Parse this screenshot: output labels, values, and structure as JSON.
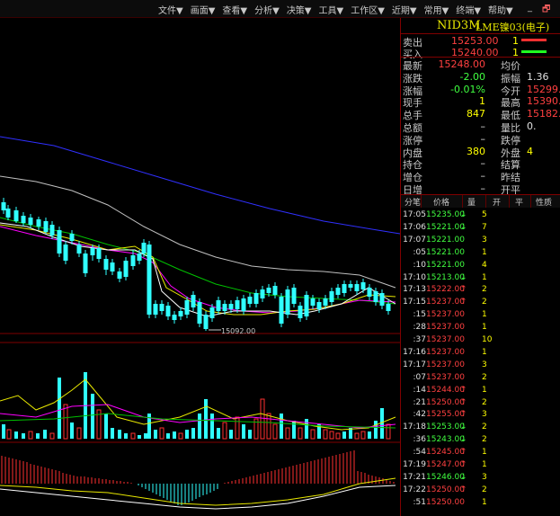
{
  "menu": [
    "文件▼",
    "画面▼",
    "查看▼",
    "分析▼",
    "决策▼",
    "工具▼",
    "工作区▼",
    "近期▼",
    "常用▼",
    "终端▼",
    "帮助▼"
  ],
  "window_controls": [
    "_",
    "🗗"
  ],
  "instrument": {
    "code": "NID3M",
    "name": "LME镍03(电子)"
  },
  "orderbook": [
    {
      "label": "卖出",
      "price": "15253.00",
      "qty": "1",
      "bar_color": "#ff3030"
    },
    {
      "label": "买入",
      "price": "15240.00",
      "qty": "1",
      "bar_color": "#20ff20"
    }
  ],
  "quote_left": [
    {
      "label": "最新",
      "value": "15248.00",
      "color": "red"
    },
    {
      "label": "涨跌",
      "value": "-2.00",
      "color": "grn"
    },
    {
      "label": "涨幅",
      "value": "-0.01%",
      "color": "grn"
    },
    {
      "label": "现手",
      "value": "1",
      "color": "yel"
    },
    {
      "label": "总手",
      "value": "847",
      "color": "yel"
    },
    {
      "label": "总额",
      "value": "–",
      "color": "wht"
    },
    {
      "label": "涨停",
      "value": "–",
      "color": "wht"
    },
    {
      "label": "内盘",
      "value": "380",
      "color": "yel"
    },
    {
      "label": "持仓",
      "value": "–",
      "color": "wht"
    },
    {
      "label": "增仓",
      "value": "–",
      "color": "wht"
    },
    {
      "label": "日增",
      "value": "–",
      "color": "wht"
    }
  ],
  "quote_right": [
    {
      "label": "均价",
      "value": "",
      "color": "wht"
    },
    {
      "label": "振幅",
      "value": "1.36",
      "color": "wht"
    },
    {
      "label": "今开",
      "value": "15299.",
      "color": "red"
    },
    {
      "label": "最高",
      "value": "15390.",
      "color": "red"
    },
    {
      "label": "最低",
      "value": "15182.",
      "color": "red"
    },
    {
      "label": "量比",
      "value": "0.",
      "color": "wht"
    },
    {
      "label": "跌停",
      "value": "",
      "color": "wht"
    },
    {
      "label": "外盘",
      "value": "4",
      "color": "yel"
    },
    {
      "label": "结算",
      "value": "",
      "color": "wht"
    },
    {
      "label": "昨结",
      "value": "",
      "color": "wht"
    },
    {
      "label": "开平",
      "value": "",
      "color": "wht"
    }
  ],
  "ticks_header": [
    "分笔",
    "价格",
    "量",
    "开",
    "平",
    "性质"
  ],
  "ticks": [
    {
      "time": "17:05",
      "price": "15235.00",
      "dir": "↓",
      "qty": "5",
      "color": "grn"
    },
    {
      "time": "17:06",
      "price": "15221.00",
      "dir": "↓",
      "qty": "7",
      "color": "grn"
    },
    {
      "time": "17:07",
      "price": "15221.00",
      "dir": "",
      "qty": "3",
      "color": "grn"
    },
    {
      "time": ":05",
      "price": "15221.00",
      "dir": "",
      "qty": "1",
      "color": "grn"
    },
    {
      "time": ":10",
      "price": "15221.00",
      "dir": "",
      "qty": "4",
      "color": "grn"
    },
    {
      "time": "17:10",
      "price": "15213.00",
      "dir": "↓",
      "qty": "1",
      "color": "grn"
    },
    {
      "time": "17:13",
      "price": "15222.00",
      "dir": "↑",
      "qty": "2",
      "color": "red"
    },
    {
      "time": "17:15",
      "price": "15237.00",
      "dir": "↑",
      "qty": "2",
      "color": "red"
    },
    {
      "time": ":15",
      "price": "15237.00",
      "dir": "",
      "qty": "1",
      "color": "red"
    },
    {
      "time": ":28",
      "price": "15237.00",
      "dir": "",
      "qty": "1",
      "color": "red"
    },
    {
      "time": ":37",
      "price": "15237.00",
      "dir": "",
      "qty": "10",
      "color": "red"
    },
    {
      "time": "17:16",
      "price": "15237.00",
      "dir": "",
      "qty": "1",
      "color": "red"
    },
    {
      "time": "17:17",
      "price": "15237.00",
      "dir": "",
      "qty": "3",
      "color": "red"
    },
    {
      "time": ":07",
      "price": "15237.00",
      "dir": "",
      "qty": "2",
      "color": "red"
    },
    {
      "time": ":14",
      "price": "15244.00",
      "dir": "↑",
      "qty": "1",
      "color": "red"
    },
    {
      "time": ":21",
      "price": "15250.00",
      "dir": "↑",
      "qty": "2",
      "color": "red"
    },
    {
      "time": ":42",
      "price": "15255.00",
      "dir": "↑",
      "qty": "3",
      "color": "red"
    },
    {
      "time": "17:18",
      "price": "15253.00",
      "dir": "↓",
      "qty": "2",
      "color": "grn"
    },
    {
      "time": ":36",
      "price": "15243.00",
      "dir": "↓",
      "qty": "2",
      "color": "grn"
    },
    {
      "time": ":54",
      "price": "15245.00",
      "dir": "↑",
      "qty": "1",
      "color": "red"
    },
    {
      "time": "17:19",
      "price": "15247.00",
      "dir": "↑",
      "qty": "1",
      "color": "red"
    },
    {
      "time": "17:21",
      "price": "15246.00",
      "dir": "↓",
      "qty": "3",
      "color": "grn"
    },
    {
      "time": "17:22",
      "price": "15250.00",
      "dir": "↑",
      "qty": "2",
      "color": "red"
    },
    {
      "time": ":51",
      "price": "15250.00",
      "dir": "",
      "qty": "1",
      "color": "red"
    }
  ],
  "chart_data": {
    "type": "candlestick",
    "low_marker": "15092.00",
    "ma_colors": [
      "#ffffff",
      "#e8e800",
      "#ff00ff",
      "#00c000",
      "#c0c0c0",
      "#3030ff"
    ],
    "up_color": "#ff3030",
    "down_color": "#30ffff"
  }
}
